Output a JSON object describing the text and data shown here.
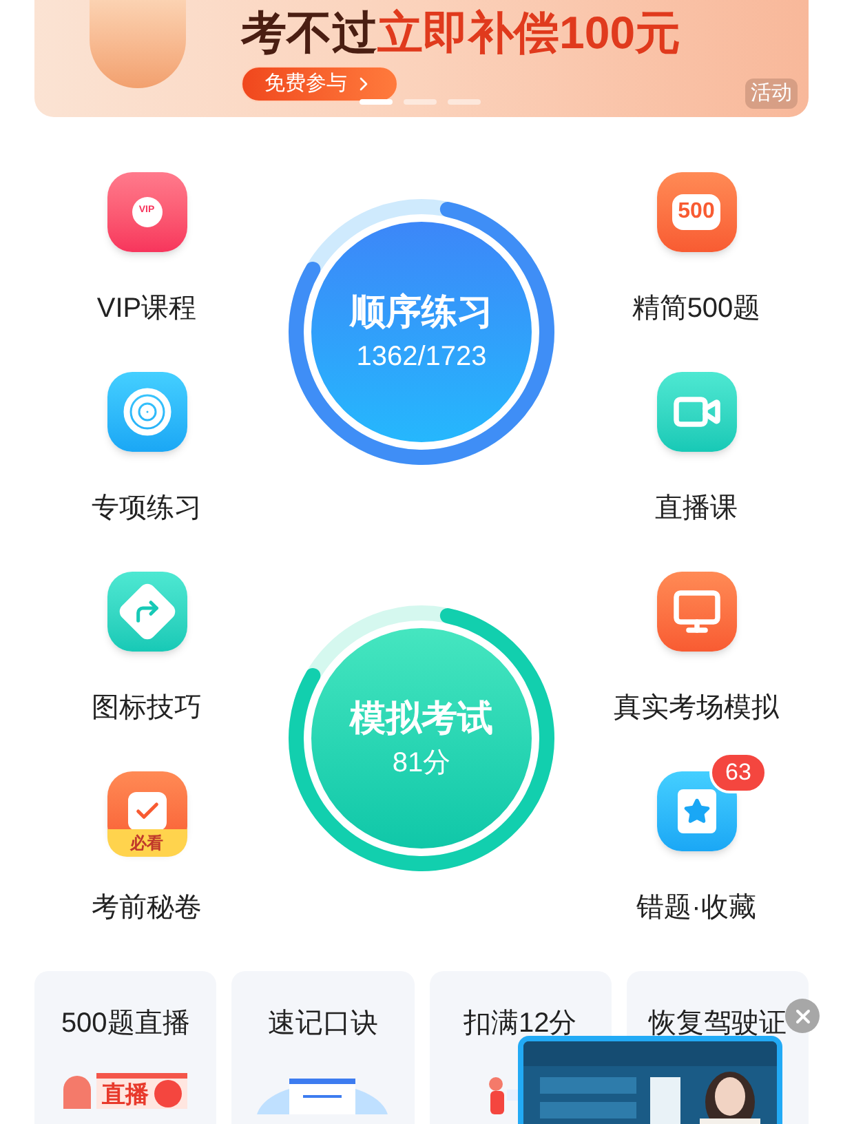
{
  "banner": {
    "headline_lead": "考不过",
    "headline_offer": "立即补偿100元",
    "button": "免费参与",
    "tag": "活动",
    "dots": [
      {
        "selected": true
      },
      {
        "selected": false
      },
      {
        "selected": false
      }
    ]
  },
  "features_left": [
    {
      "label": "VIP课程",
      "kind": "vip",
      "icon_text": "VIP"
    },
    {
      "label": "专项练习",
      "kind": "target"
    },
    {
      "label": "图标技巧",
      "kind": "turn"
    },
    {
      "label": "考前秘卷",
      "kind": "paper",
      "icon_text": "必看"
    }
  ],
  "features_right": [
    {
      "label": "精简500题",
      "kind": "five",
      "icon_text": "500"
    },
    {
      "label": "直播课",
      "kind": "video"
    },
    {
      "label": "真实考场模拟",
      "kind": "monitor"
    },
    {
      "label": "错题·收藏",
      "kind": "star",
      "badge": "63"
    }
  ],
  "circles": [
    {
      "kind": "blue",
      "title": "顺序练习",
      "value": "1362/1723"
    },
    {
      "kind": "green",
      "title": "模拟考试",
      "value": "81分"
    }
  ],
  "cards": [
    {
      "title": "500题直播",
      "kind": "live",
      "image_text": "直播"
    },
    {
      "title": "速记口诀",
      "kind": "doc"
    },
    {
      "title": "扣满12分",
      "kind": "person"
    },
    {
      "title": "恢复驾驶证",
      "kind": "blank"
    }
  ]
}
